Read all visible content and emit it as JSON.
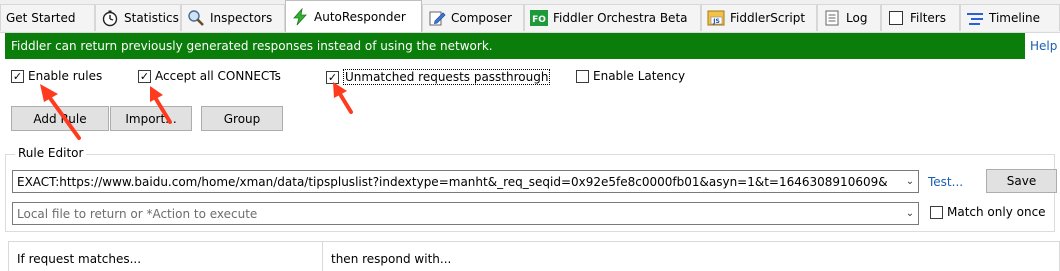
{
  "tabs": [
    {
      "label": "Get Started",
      "icon": "none"
    },
    {
      "label": "Statistics",
      "icon": "stopwatch-icon"
    },
    {
      "label": "Inspectors",
      "icon": "magnifier-icon"
    },
    {
      "label": "AutoResponder",
      "icon": "lightning-icon",
      "active": true
    },
    {
      "label": "Composer",
      "icon": "pencil-icon"
    },
    {
      "label": "Fiddler Orchestra Beta",
      "icon": "fo-badge-icon",
      "badge": "FO"
    },
    {
      "label": "FiddlerScript",
      "icon": "js-script-icon",
      "badge": "JS"
    },
    {
      "label": "Log",
      "icon": "log-icon"
    },
    {
      "label": "Filters",
      "icon": "checkbox-icon"
    },
    {
      "label": "Timeline",
      "icon": "timeline-icon"
    }
  ],
  "banner": {
    "text": "Fiddler can return previously generated responses instead of using the network.",
    "help": "Help",
    "color": "#0a7d0a"
  },
  "options": {
    "enable_rules": {
      "label": "Enable rules",
      "checked": true
    },
    "accept_connects": {
      "label": "Accept all CONNECTs",
      "checked": true
    },
    "unmatched_passthrough": {
      "label": "Unmatched requests passthrough",
      "checked": true
    },
    "enable_latency": {
      "label": "Enable Latency",
      "checked": false
    }
  },
  "buttons": {
    "add_rule": "Add Rule",
    "import": "Import...",
    "group": "Group"
  },
  "rule_editor": {
    "label": "Rule Editor",
    "match_value": "EXACT:https://www.baidu.com/home/xman/data/tipspluslist?indextype=manht&_req_seqid=0x92e5fe8c0000fb01&asyn=1&t=1646308910609&",
    "action_placeholder": "Local file to return or *Action to execute",
    "test_link": "Test...",
    "save": "Save",
    "match_only_once": {
      "label": "Match only once",
      "checked": false
    }
  },
  "rules_table": {
    "columns": [
      "If request matches...",
      "then respond with..."
    ]
  },
  "annotation": {
    "color": "#ff3b1f",
    "shape": "red-arrow"
  }
}
